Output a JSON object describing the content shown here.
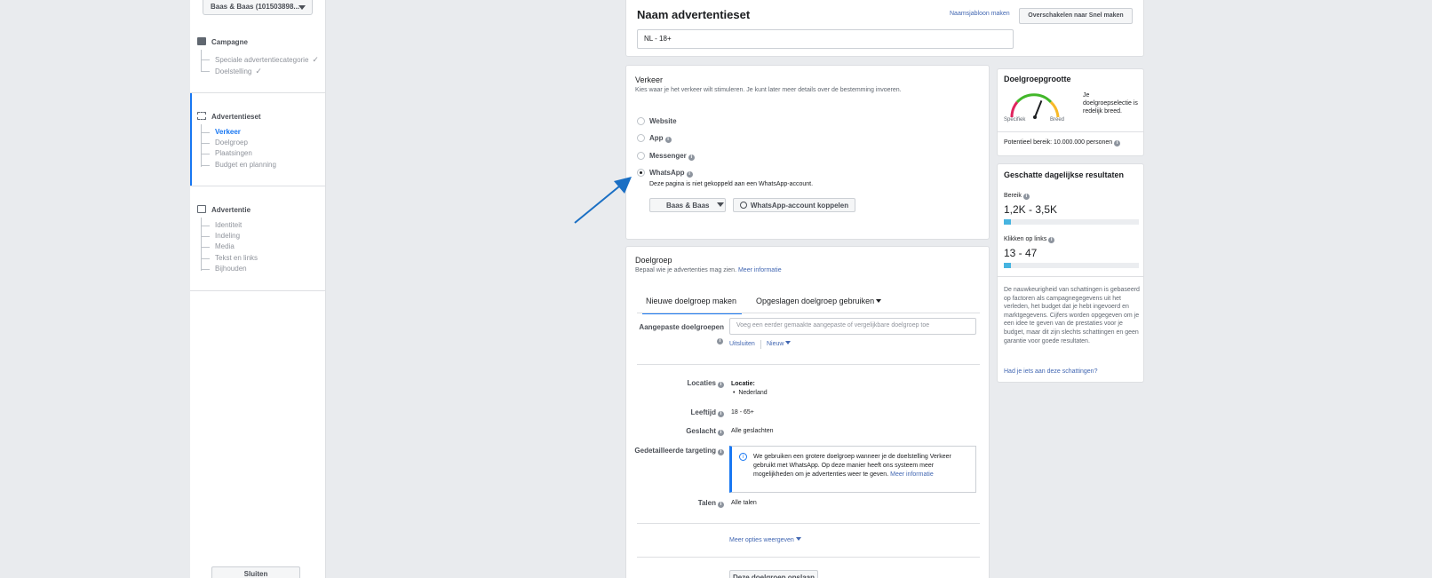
{
  "nav": {
    "account_select": "Baas & Baas (101503898...",
    "campaign": {
      "title": "Campagne",
      "items": [
        "Speciale advertentiecategorie",
        "Doelstelling"
      ]
    },
    "adset": {
      "title": "Advertentieset",
      "items": [
        "Verkeer",
        "Doelgroep",
        "Plaatsingen",
        "Budget en planning"
      ]
    },
    "ad": {
      "title": "Advertentie",
      "items": [
        "Identiteit",
        "Indeling",
        "Media",
        "Tekst en links",
        "Bijhouden"
      ]
    },
    "close_label": "Sluiten",
    "check_glyph": "✓"
  },
  "adset_name": {
    "title": "Naam advertentieset",
    "template_link": "Naamsjabloon maken",
    "switch_button": "Overschakelen naar Snel maken",
    "value": "NL - 18+"
  },
  "traffic": {
    "title": "Verkeer",
    "subtitle": "Kies waar je het verkeer wilt stimuleren. Je kunt later meer details over de bestemming invoeren.",
    "options": [
      "Website",
      "App",
      "Messenger",
      "WhatsApp"
    ],
    "selected": "WhatsApp",
    "whatsapp_note": "Deze pagina is niet gekoppeld aan een WhatsApp-account.",
    "page_select": "Baas & Baas",
    "connect_button": "WhatsApp-account koppelen"
  },
  "audience": {
    "title": "Doelgroep",
    "subtitle": "Bepaal wie je advertenties mag zien.",
    "more_info": "Meer informatie",
    "tabs": [
      "Nieuwe doelgroep maken",
      "Opgeslagen doelgroep gebruiken"
    ],
    "custom_label": "Aangepaste doelgroepen",
    "custom_placeholder": "Voeg een eerder gemaakte aangepaste of vergelijkbare doelgroep toe",
    "exclude_link": "Uitsluiten",
    "new_link": "Nieuw",
    "locations_label": "Locaties",
    "location_heading": "Locatie:",
    "location_value": "Nederland",
    "age_label": "Leeftijd",
    "age_value": "18 - 65+",
    "gender_label": "Geslacht",
    "gender_value": "Alle geslachten",
    "detailed_label": "Gedetailleerde targeting",
    "notice_text": "We gebruiken een grotere doelgroep wanneer je de doelstelling Verkeer gebruikt met WhatsApp. Op deze manier heeft ons systeem meer mogelijkheden om je advertenties weer te geven.",
    "notice_link": "Meer informatie",
    "languages_label": "Talen",
    "languages_value": "Alle talen",
    "more_options": "Meer opties weergeven",
    "save_button": "Deze doelgroep opslaan"
  },
  "audience_size": {
    "title": "Doelgroepgrootte",
    "gauge_left": "Specifiek",
    "gauge_right": "Breed",
    "gauge_level": 0.62,
    "description": "Je doelgroepselectie is redelijk breed.",
    "potential_reach": "Potentieel bereik: 10.000.000 personen"
  },
  "daily_results": {
    "title": "Geschatte dagelijkse resultaten",
    "reach_label": "Bereik",
    "reach_value": "1,2K - 3,5K",
    "reach_fill": 0.05,
    "clicks_label": "Klikken op links",
    "clicks_value": "13 - 47",
    "clicks_fill": 0.05,
    "disclaimer": "De nauwkeurigheid van schattingen is gebaseerd op factoren als campagnegegevens uit het verleden, het budget dat je hebt ingevoerd en marktgegevens. Cijfers worden opgegeven om je een idee te geven van de prestaties voor je budget, maar dit zijn slechts schattingen en geen garantie voor goede resultaten.",
    "feedback_link": "Had je iets aan deze schattingen?"
  },
  "colors": {
    "accent": "#1877f2",
    "arrow": "#1a6fc4",
    "bar_fill": "#47b4e0"
  }
}
